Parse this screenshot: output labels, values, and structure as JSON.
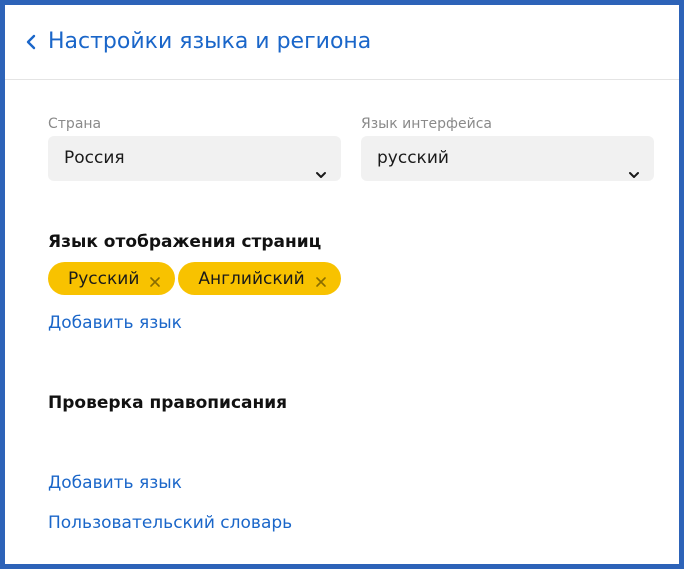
{
  "header": {
    "title": "Настройки языка и региона",
    "back_icon": "chevron-left-icon"
  },
  "country": {
    "label": "Страна",
    "value": "Россия"
  },
  "interface_language": {
    "label": "Язык интерфейса",
    "value": "русский"
  },
  "page_languages": {
    "title": "Язык отображения страниц",
    "chips": [
      {
        "label": "Русский"
      },
      {
        "label": "Английский"
      }
    ],
    "add_link": "Добавить язык"
  },
  "spellcheck": {
    "title": "Проверка правописания",
    "add_link": "Добавить язык",
    "dictionary_link": "Пользовательский словарь"
  },
  "colors": {
    "accent": "#1a66c9",
    "chip": "#f8c200",
    "frame": "#2d63b8",
    "field_bg": "#f1f1f1"
  }
}
